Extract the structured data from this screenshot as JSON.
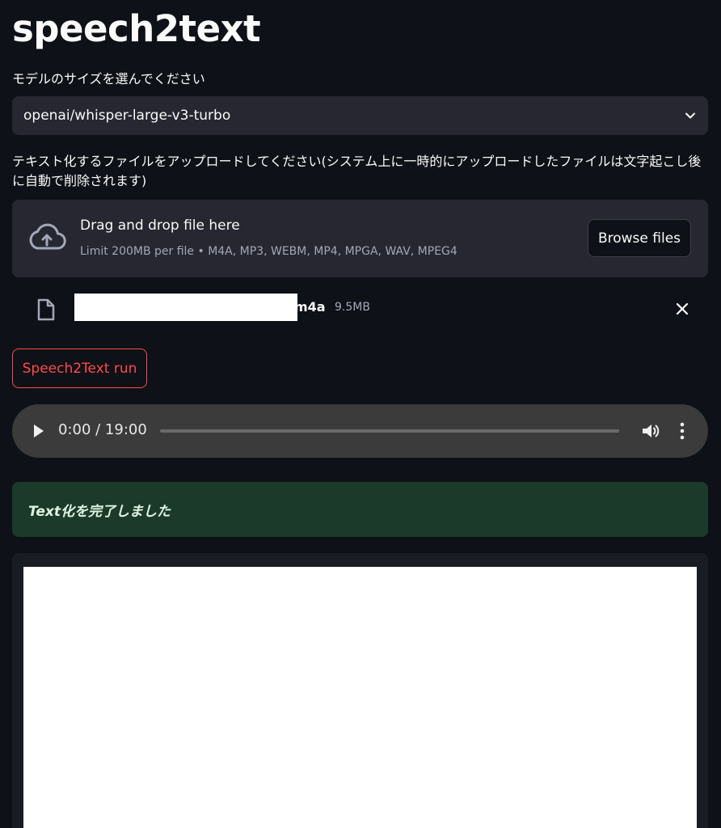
{
  "app": {
    "title": "speech2text"
  },
  "model_select": {
    "label": "モデルのサイズを選んでください",
    "value": "openai/whisper-large-v3-turbo"
  },
  "uploader": {
    "label": "テキスト化するファイルをアップロードしてください(システム上に一時的にアップロードしたファイルは文字起こし後に自動で削除されます)",
    "dropzone_title": "Drag and drop file here",
    "limit_text": "Limit 200MB per file • M4A, MP3, WEBM, MP4, MPGA, WAV, MPEG4",
    "browse_label": "Browse files",
    "icon": "cloud-upload-icon"
  },
  "uploaded_file": {
    "name_suffix": "m4a",
    "size": "9.5MB",
    "icon": "file-icon"
  },
  "run_button": {
    "label": "Speech2Text run"
  },
  "audio_player": {
    "time": "0:00 / 19:00",
    "progress": 0
  },
  "status": {
    "message": "Text化を完了しました"
  },
  "result": {
    "text": ""
  },
  "colors": {
    "background": "#0e1117",
    "widget": "#262730",
    "accent": "#ff4b4b",
    "success_bg": "#1b3a29"
  }
}
